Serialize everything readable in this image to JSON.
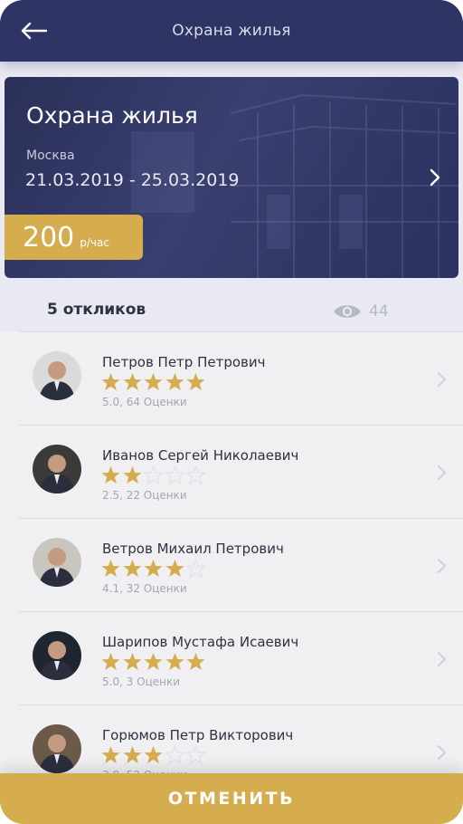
{
  "header": {
    "title": "Охрана жилья",
    "back_icon": "arrow-left-icon"
  },
  "job": {
    "title": "Охрана жилья",
    "city": "Москва",
    "dates": "21.03.2019 - 25.03.2019",
    "price": "200",
    "price_unit": "р/час"
  },
  "responses": {
    "count_label": "5 откликов",
    "views": "44"
  },
  "candidates": [
    {
      "name": "Петров Петр Петрович",
      "stars": 5,
      "rating_text": "5.0, 64 Оценки",
      "avatar_bg": "#d9dadc"
    },
    {
      "name": "Иванов Сергей Николаевич",
      "stars": 2,
      "rating_text": "2.5, 22 Оценки",
      "avatar_bg": "#3a3a36"
    },
    {
      "name": "Ветров Михаил Петрович",
      "stars": 4,
      "rating_text": "4.1, 32 Оценки",
      "avatar_bg": "#c9c6c0"
    },
    {
      "name": "Шарипов Мустафа Исаевич",
      "stars": 5,
      "rating_text": "5.0, 3 Оценки",
      "avatar_bg": "#1f2630"
    },
    {
      "name": "Горюмов Петр Викторович",
      "stars": 3,
      "rating_text": "3.8, 52 Оценки",
      "avatar_bg": "#6b5a4a"
    }
  ],
  "footer": {
    "cancel_label": "ОТМЕНИТЬ"
  },
  "colors": {
    "navy": "#2e3463",
    "gold": "#d5ac4e",
    "background": "#f0f0f2"
  }
}
